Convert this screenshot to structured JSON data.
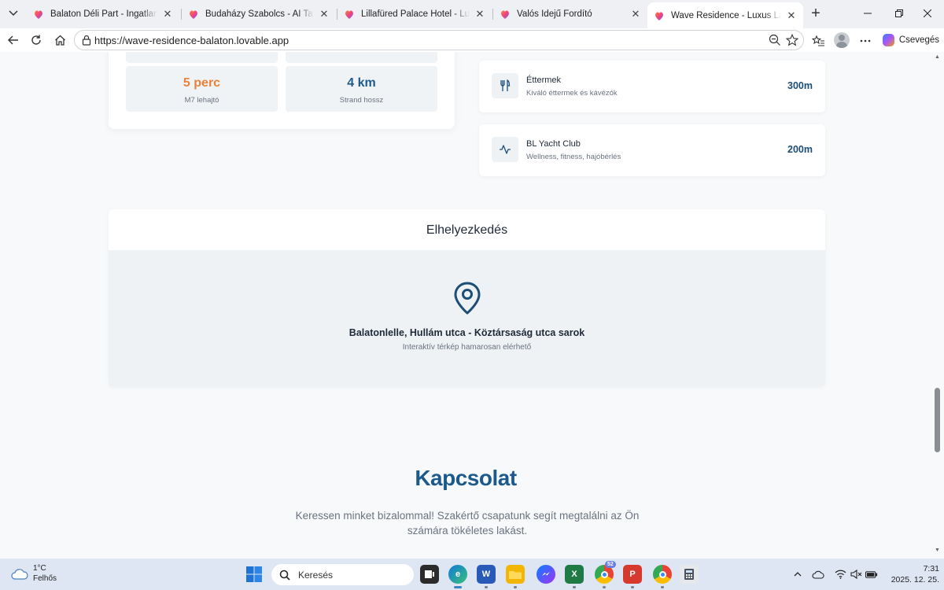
{
  "browser": {
    "tabs": [
      {
        "title": "Balaton Déli Part - Ingatlanfejlesztés",
        "active": false
      },
      {
        "title": "Budaházy Szabolcs - AI Tanácsadó",
        "active": false
      },
      {
        "title": "Lillafüred Palace Hotel - Luxury Hotel",
        "active": false
      },
      {
        "title": "Valós Idejű Fordító",
        "active": false
      },
      {
        "title": "Wave Residence - Luxus Lakások a Balatonnál",
        "active": true
      }
    ],
    "new_tab_label": "+",
    "url": "https://wave-residence-balaton.lovable.app",
    "copilot_label": "Csevegés",
    "accent": "#1d5a8c"
  },
  "page": {
    "stats": [
      {
        "value": "5 perc",
        "label": "M7 lehajtó",
        "color": "#e8833a"
      },
      {
        "value": "4 km",
        "label": "Strand hossz",
        "color": "#1d5a8c"
      }
    ],
    "poi": [
      {
        "icon": "utensils-icon",
        "title": "Éttermek",
        "subtitle": "Kiváló éttermek és kávézók",
        "distance": "300m"
      },
      {
        "icon": "activity-icon",
        "title": "BL Yacht Club",
        "subtitle": "Wellness, fitness, hajóbérlés",
        "distance": "200m"
      }
    ],
    "location": {
      "heading": "Elhelyezkedés",
      "address": "Balatonlelle, Hullám utca - Köztársaság utca sarok",
      "note": "Interaktív térkép hamarosan elérhető"
    },
    "contact": {
      "title": "Kapcsolat",
      "description": "Keressen minket bizalommal! Szakértő csapatunk segít megtalálni az Ön számára tökéletes lakást."
    }
  },
  "taskbar": {
    "weather_temp": "1°C",
    "weather_desc": "Felhős",
    "search_placeholder": "Keresés",
    "time": "7:31",
    "date": "2025. 12. 25.",
    "chrome_badge": "52"
  }
}
